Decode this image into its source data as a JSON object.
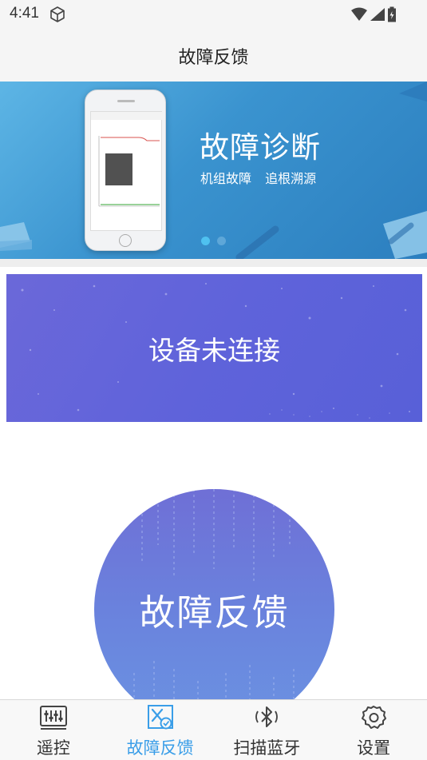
{
  "status_bar": {
    "time": "4:41",
    "icons": [
      "cube-icon",
      "wifi-icon",
      "cellular-signal-icon",
      "battery-charging-icon"
    ]
  },
  "header": {
    "title": "故障反馈"
  },
  "banner": {
    "title": "故障诊断",
    "subtitle": "机组故障 追根溯源",
    "page_count": 2,
    "active_page": 1,
    "colors": {
      "background": "#3a93cf",
      "dot_active": "#4fc1f0",
      "dot_inactive": "#5ea7d8"
    }
  },
  "connection": {
    "status_text": "设备未连接",
    "color": "#5f63da"
  },
  "feedback_button": {
    "label": "故障反馈",
    "color": "#6a82dd"
  },
  "bottom_nav": {
    "items": [
      {
        "label": "遥控",
        "icon": "remote-control-icon",
        "active": false
      },
      {
        "label": "故障反馈",
        "icon": "fault-feedback-icon",
        "active": true
      },
      {
        "label": "扫描蓝牙",
        "icon": "bluetooth-icon",
        "active": false
      },
      {
        "label": "设置",
        "icon": "gear-icon",
        "active": false
      }
    ],
    "colors": {
      "active": "#3a9ee8",
      "inactive": "#333333"
    }
  }
}
